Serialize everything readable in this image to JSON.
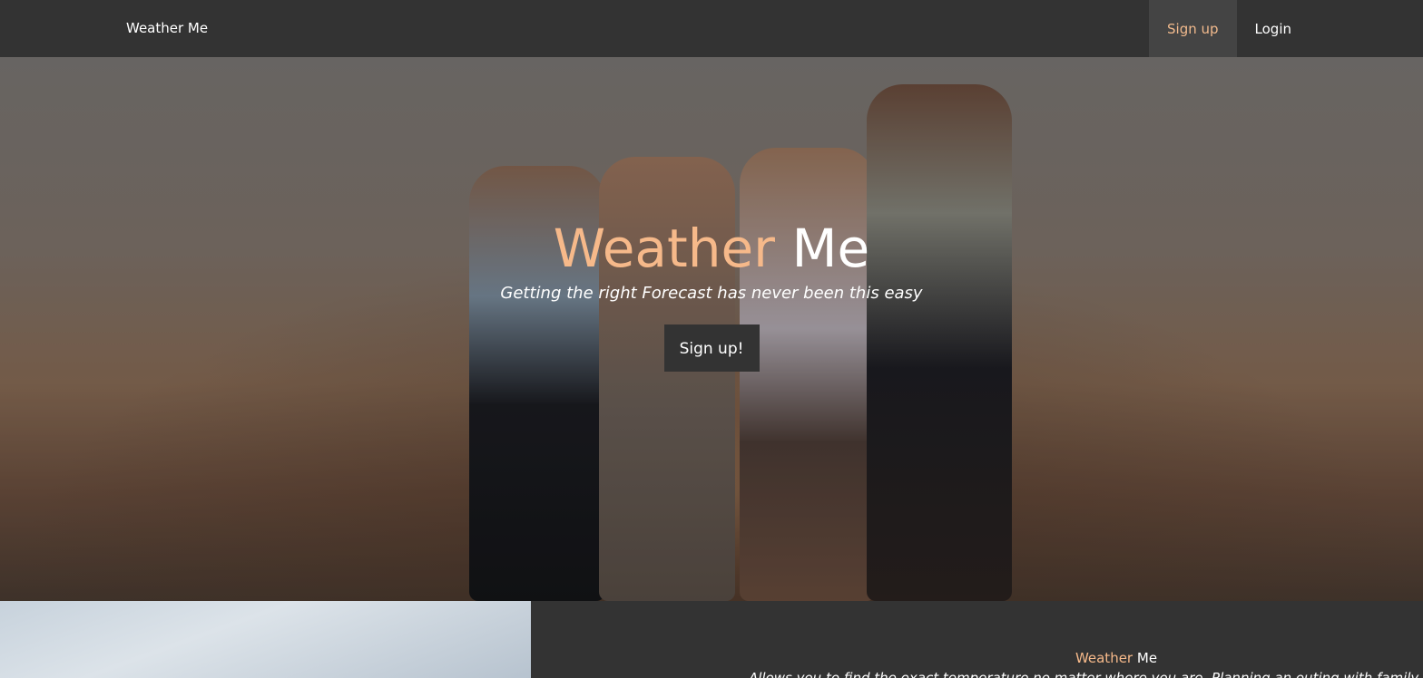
{
  "nav": {
    "brand": "Weather Me",
    "links": [
      {
        "label": "Sign up",
        "active": true
      },
      {
        "label": "Login",
        "active": false
      }
    ]
  },
  "hero": {
    "title_accent": "Weather",
    "title_rest": "Me",
    "subtitle": "Getting the right Forecast has never been this easy",
    "button_label": "Sign up!"
  },
  "about": {
    "title_accent": "Weather",
    "title_rest": "Me",
    "description": "Allows you to find the exact temperature no matter where you are. Planning an outing with family friends"
  },
  "colors": {
    "accent": "#f6b98a",
    "nav_bg": "#333333",
    "active_nav_bg": "#444444"
  }
}
